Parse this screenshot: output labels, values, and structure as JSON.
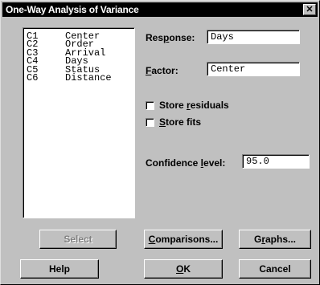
{
  "window": {
    "title": "One-Way Analysis of Variance",
    "close_glyph": "✕"
  },
  "columns_list": [
    {
      "id": "C1",
      "name": "Center"
    },
    {
      "id": "C2",
      "name": "Order"
    },
    {
      "id": "C3",
      "name": "Arrival"
    },
    {
      "id": "C4",
      "name": "Days"
    },
    {
      "id": "C5",
      "name": "Status"
    },
    {
      "id": "C6",
      "name": "Distance"
    }
  ],
  "response": {
    "label_pre": "Res",
    "label_u": "p",
    "label_post": "onse:",
    "value": "Days"
  },
  "factor": {
    "label_pre": "",
    "label_u": "F",
    "label_post": "actor:",
    "value": "Center"
  },
  "store_residuals": {
    "label_pre": "Store ",
    "label_u": "r",
    "label_post": "esiduals",
    "checked": false
  },
  "store_fits": {
    "label_pre": "",
    "label_u": "S",
    "label_post": "tore fits",
    "checked": false
  },
  "confidence": {
    "label_pre": "Confidence ",
    "label_u": "l",
    "label_post": "evel:",
    "value": "95.0"
  },
  "buttons": {
    "select": "Select",
    "comparisons_u": "C",
    "comparisons_rest": "omparisons...",
    "graphs_pre": "G",
    "graphs_u": "r",
    "graphs_rest": "aphs...",
    "help": "Help",
    "ok_u": "O",
    "ok_rest": "K",
    "cancel": "Cancel"
  }
}
